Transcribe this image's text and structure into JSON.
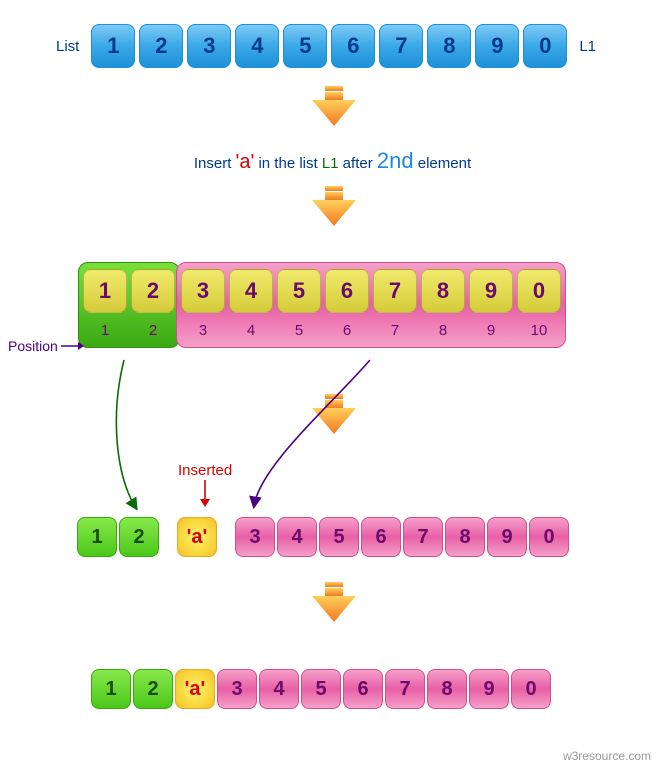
{
  "labels": {
    "list": "List",
    "l1": "L1",
    "position": "Position",
    "inserted": "Inserted",
    "footer": "w3resource.com"
  },
  "instruction": {
    "pre": "Insert ",
    "a": "'a'",
    "mid": " in the list ",
    "l1": "L1",
    "after": " after ",
    "second": "2nd",
    "post": " element"
  },
  "list1": [
    "1",
    "2",
    "3",
    "4",
    "5",
    "6",
    "7",
    "8",
    "9",
    "0"
  ],
  "block": {
    "green": [
      "1",
      "2"
    ],
    "pink": [
      "3",
      "4",
      "5",
      "6",
      "7",
      "8",
      "9",
      "0"
    ],
    "positions_green": [
      "1",
      "2"
    ],
    "positions_pink": [
      "3",
      "4",
      "5",
      "6",
      "7",
      "8",
      "9",
      "10"
    ]
  },
  "inserted_char": "'a'",
  "result": {
    "green": [
      "1",
      "2"
    ],
    "a": "'a'",
    "pink": [
      "3",
      "4",
      "5",
      "6",
      "7",
      "8",
      "9",
      "0"
    ]
  }
}
